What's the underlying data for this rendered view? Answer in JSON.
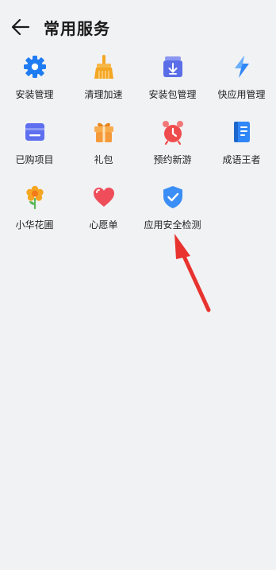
{
  "header": {
    "title": "常用服务",
    "back_icon": "arrow-left-icon"
  },
  "services": [
    {
      "label": "安装管理",
      "icon": "gear-icon",
      "color": "#1f7cf2"
    },
    {
      "label": "清理加速",
      "icon": "broom-icon",
      "color": "#f5a623"
    },
    {
      "label": "安装包管理",
      "icon": "package-download-icon",
      "color": "#5b6ee8"
    },
    {
      "label": "快应用管理",
      "icon": "lightning-icon",
      "color": "#2f86f6"
    },
    {
      "label": "已购项目",
      "icon": "purchased-icon",
      "color": "#5e6ff0"
    },
    {
      "label": "礼包",
      "icon": "gift-icon",
      "color": "#f59a3a"
    },
    {
      "label": "预约新游",
      "icon": "alarm-clock-icon",
      "color": "#ef4d4d"
    },
    {
      "label": "成语王者",
      "icon": "book-icon",
      "color": "#2f86f6"
    },
    {
      "label": "小华花圃",
      "icon": "flower-icon",
      "color": "#f5a623"
    },
    {
      "label": "心愿单",
      "icon": "heart-icon",
      "color": "#ef4d5a"
    },
    {
      "label": "应用安全检测",
      "icon": "shield-check-icon",
      "color": "#3a8ef6"
    }
  ],
  "annotation_color": "#e8332f"
}
